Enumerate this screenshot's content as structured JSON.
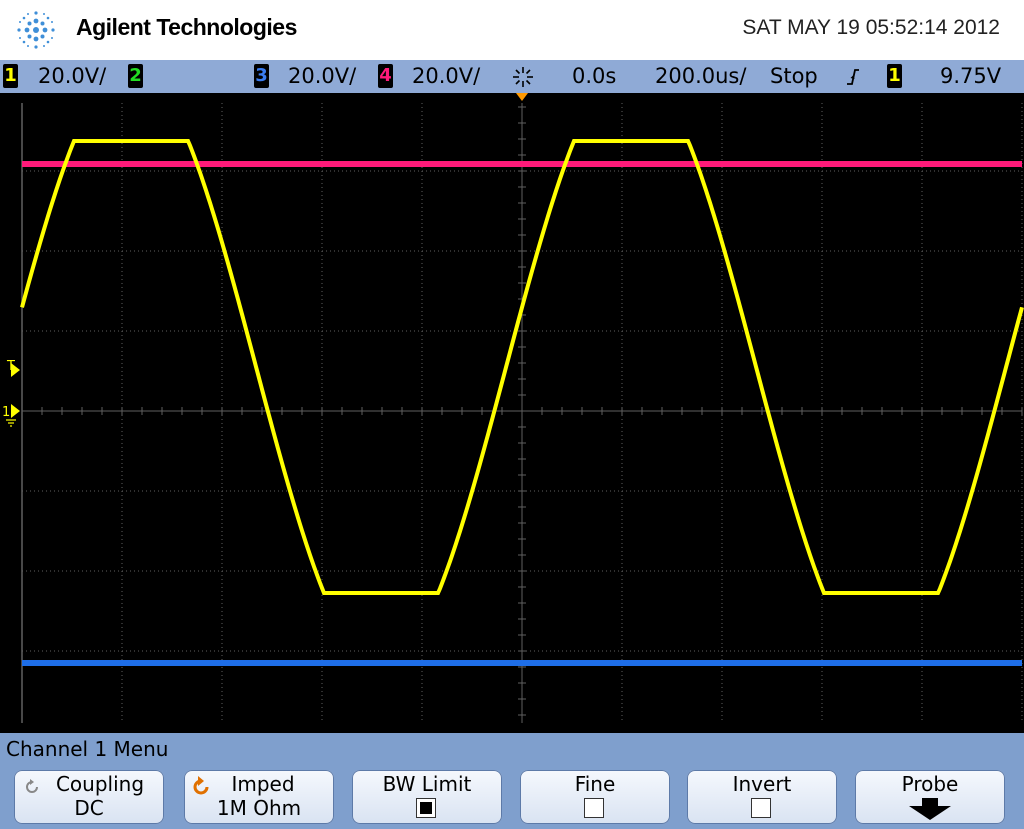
{
  "header": {
    "brand": "Agilent Technologies",
    "datetime": "SAT MAY 19 05:52:14 2012"
  },
  "status": {
    "ch1_num": "1",
    "ch1_scale": "20.0V/",
    "ch2_num": "2",
    "ch3_num": "3",
    "ch3_scale": "20.0V/",
    "ch4_num": "4",
    "ch4_scale": "20.0V/",
    "delay": "0.0s",
    "timebase": "200.0us/",
    "run_state": "Stop",
    "trig_src": "1",
    "trig_level": "9.75V"
  },
  "colors": {
    "ch1": "#ffff00",
    "ch2": "#22dd22",
    "ch3": "#1e6ee8",
    "ch4": "#ff1a7a",
    "trigger_marker": "#ff9900",
    "grid": "#606060"
  },
  "markers": {
    "trigger": "T",
    "ch1": "1"
  },
  "menu": {
    "title": "Channel 1  Menu",
    "coupling_label": "Coupling",
    "coupling_value": "DC",
    "imped_label": "Imped",
    "imped_value": "1M Ohm",
    "bwlimit_label": "BW Limit",
    "fine_label": "Fine",
    "invert_label": "Invert",
    "probe_label": "Probe"
  },
  "icons": {
    "logo": "agilent-spark-icon",
    "trigger_mode": "sparkle-icon",
    "trigger_slope": "rising-edge-icon",
    "cycle": "cycle-arrow-icon",
    "probe_arrow": "arrow-down-icon"
  },
  "toggles": {
    "bw_limit": true,
    "fine": false,
    "invert": false
  },
  "waveforms": {
    "ch1": {
      "shape": "clipped-sine",
      "periods_on_screen": 2
    },
    "ch4": {
      "shape": "flat-dc"
    },
    "ch3": {
      "shape": "flat-dc"
    }
  }
}
